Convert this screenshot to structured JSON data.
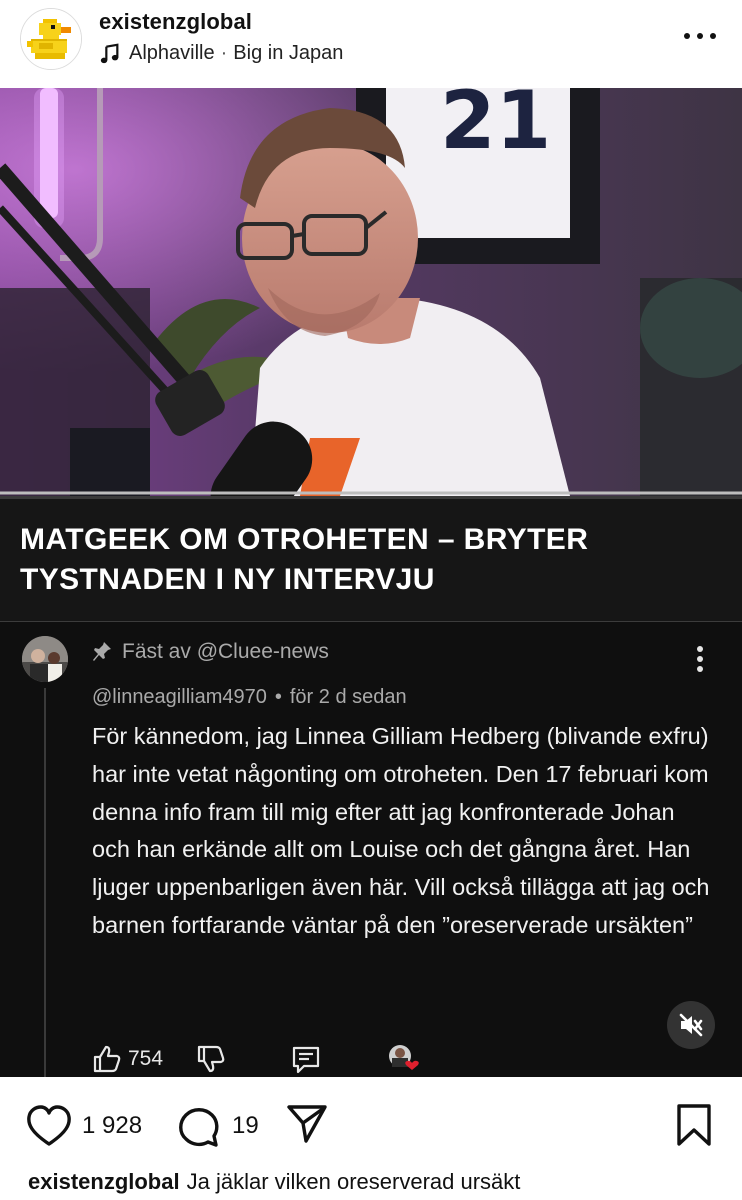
{
  "header": {
    "username": "existenzglobal",
    "audio_artist": "Alphaville",
    "audio_separator": "·",
    "audio_track": "Big in Japan"
  },
  "video": {
    "headline": "MATGEEK OM OTROHETEN – BRYTER TYSTNADEN I NY INTERVJU"
  },
  "comment": {
    "pinned_label": "Fäst av @Cluee-news",
    "author": "@linneagilliam4970",
    "meta_separator": "•",
    "time": "för 2 d sedan",
    "text": "För kännedom, jag Linnea Gilliam Hedberg (blivande exfru) har inte vetat någonting om otroheten. Den 17 februari kom denna info fram till mig efter att jag konfronterade Johan och han erkände allt om Louise och det gångna året. Han ljuger uppenbarligen även här. Vill också tillägga att jag och barnen fortfarande väntar på den ”oreserverade ursäkten”",
    "like_count": "754"
  },
  "actions": {
    "likes": "1 928",
    "comments": "19"
  },
  "caption": {
    "username": "existenzglobal",
    "text": "Ja jäklar vilken  oreserverad ursäkt"
  },
  "colors": {
    "title_band": "#161616",
    "comment_bg": "#0f0f0f",
    "muted_text": "#aaaaaa"
  },
  "icons": [
    "duck-avatar-icon",
    "music-note-icon",
    "more-horizontal-icon",
    "pin-icon",
    "more-vertical-icon",
    "mute-icon",
    "thumbs-up-icon",
    "thumbs-down-icon",
    "reply-icon",
    "heart-icon",
    "comment-icon",
    "share-icon",
    "bookmark-icon"
  ]
}
